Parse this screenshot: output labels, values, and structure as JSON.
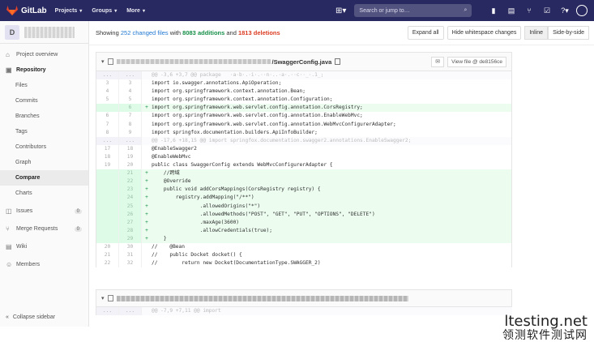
{
  "topbar": {
    "brand": "GitLab",
    "nav": [
      "Projects",
      "Groups",
      "More"
    ],
    "search_placeholder": "Search or jump to…",
    "colors": {
      "bg": "#292961",
      "fox": "#e24329"
    }
  },
  "sidebar": {
    "project_initial": "D",
    "items": [
      {
        "label": "Project overview"
      },
      {
        "label": "Repository"
      },
      {
        "label": "Files"
      },
      {
        "label": "Commits"
      },
      {
        "label": "Branches"
      },
      {
        "label": "Tags"
      },
      {
        "label": "Contributors"
      },
      {
        "label": "Graph"
      },
      {
        "label": "Compare"
      },
      {
        "label": "Charts"
      },
      {
        "label": "Issues",
        "count": "0"
      },
      {
        "label": "Merge Requests",
        "count": "0"
      },
      {
        "label": "Wiki"
      },
      {
        "label": "Members"
      }
    ],
    "collapse_label": "Collapse sidebar"
  },
  "summary": {
    "prefix": "Showing ",
    "changed": "252 changed files",
    "with": " with ",
    "additions": "8083 additions",
    "and": " and ",
    "deletions": "1813 deletions"
  },
  "buttons": {
    "expand_all": "Expand all",
    "hide_whitespace": "Hide whitespace changes",
    "inline": "Inline",
    "side_by_side": "Side-by-side"
  },
  "file1": {
    "path_tail": "/SwaggerConfig.java",
    "view_file": "View file @ de8156ce"
  },
  "diff_lines": [
    {
      "type": "hunk",
      "old": "...",
      "new": "...",
      "code": "@@ -3,6 +3,7 @@ package   ·a·b·.·i·.··n·..·a·.··c··_·.1_;"
    },
    {
      "type": "ctx",
      "old": "3",
      "new": "3",
      "code": "import io.swagger.annotations.ApiOperation;"
    },
    {
      "type": "ctx",
      "old": "4",
      "new": "4",
      "code": "import org.springframework.context.annotation.Bean;"
    },
    {
      "type": "ctx",
      "old": "5",
      "new": "5",
      "code": "import org.springframework.context.annotation.Configuration;"
    },
    {
      "type": "add",
      "old": "",
      "new": "6",
      "code": "import org.springframework.web.servlet.config.annotation.CorsRegistry;"
    },
    {
      "type": "ctx",
      "old": "6",
      "new": "7",
      "code": "import org.springframework.web.servlet.config.annotation.EnableWebMvc;"
    },
    {
      "type": "ctx",
      "old": "7",
      "new": "8",
      "code": "import org.springframework.web.servlet.config.annotation.WebMvcConfigurerAdapter;"
    },
    {
      "type": "ctx",
      "old": "8",
      "new": "9",
      "code": "import springfox.documentation.builders.ApiInfoBuilder;"
    },
    {
      "type": "hunk",
      "old": "...",
      "new": "...",
      "code": "@@ -17,6 +18,15 @@ import springfox.documentation.swagger2.annotations.EnableSwagger2;"
    },
    {
      "type": "ctx",
      "old": "17",
      "new": "18",
      "code": "@EnableSwagger2"
    },
    {
      "type": "ctx",
      "old": "18",
      "new": "19",
      "code": "@EnableWebMvc"
    },
    {
      "type": "ctx",
      "old": "19",
      "new": "20",
      "code": "public class SwaggerConfig extends WebMvcConfigurerAdapter {"
    },
    {
      "type": "add",
      "old": "",
      "new": "21",
      "code": "    //跨域"
    },
    {
      "type": "add",
      "old": "",
      "new": "22",
      "code": "    @Override"
    },
    {
      "type": "add",
      "old": "",
      "new": "23",
      "code": "    public void addCorsMappings(CorsRegistry registry) {"
    },
    {
      "type": "add",
      "old": "",
      "new": "24",
      "code": "        registry.addMapping(\"/**\")"
    },
    {
      "type": "add",
      "old": "",
      "new": "25",
      "code": "                .allowedOrigins(\"*\")"
    },
    {
      "type": "add",
      "old": "",
      "new": "26",
      "code": "                .allowedMethods(\"POST\", \"GET\", \"PUT\", \"OPTIONS\", \"DELETE\")"
    },
    {
      "type": "add",
      "old": "",
      "new": "27",
      "code": "                .maxAge(3600)"
    },
    {
      "type": "add",
      "old": "",
      "new": "28",
      "code": "                .allowCredentials(true);"
    },
    {
      "type": "add",
      "old": "",
      "new": "29",
      "code": "    }"
    },
    {
      "type": "ctx",
      "old": "20",
      "new": "30",
      "code": "//    @Bean"
    },
    {
      "type": "ctx",
      "old": "21",
      "new": "31",
      "code": "//    public Docket docket() {"
    },
    {
      "type": "ctx",
      "old": "22",
      "new": "32",
      "code": "//        return new Docket(DocumentationType.SWAGGER_2)"
    }
  ],
  "file2": {
    "hunk": "@@ -7,9 +7,11 @@ import"
  },
  "watermark": {
    "line1": "ltesting.net",
    "line2": "领测软件测试网"
  }
}
